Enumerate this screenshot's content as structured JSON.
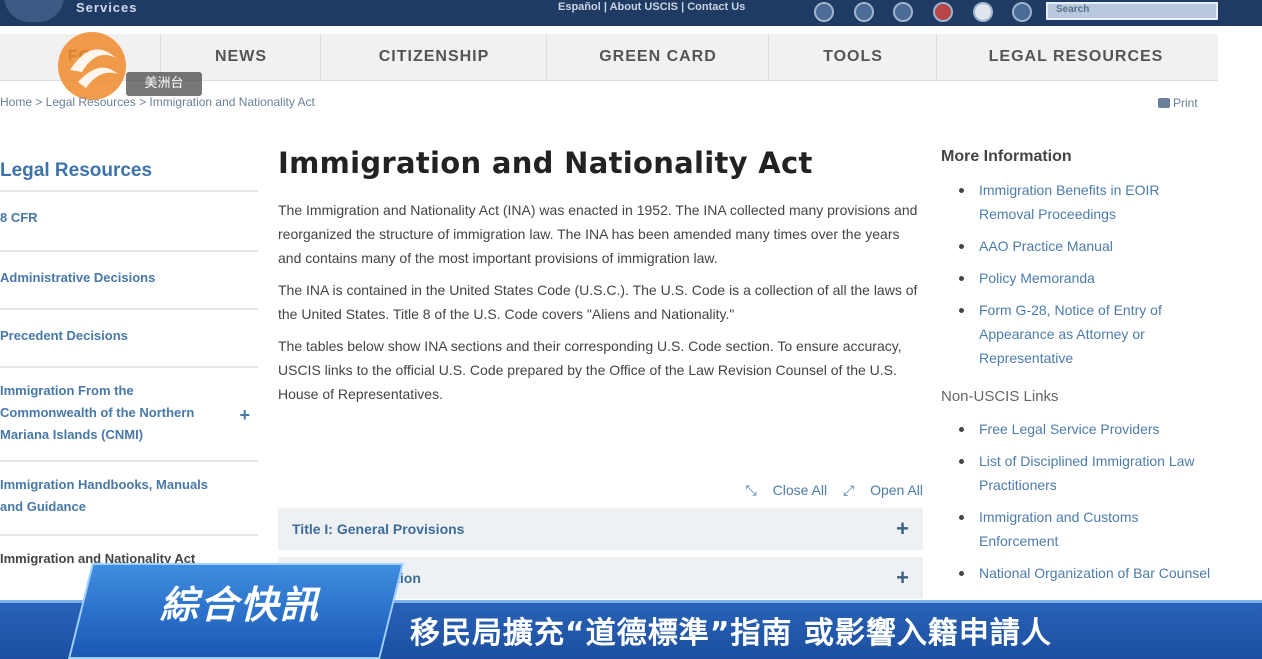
{
  "header": {
    "brand_text": "Services",
    "util_links": "Español | About USCIS | Contact Us",
    "search_placeholder": "Search"
  },
  "nav": {
    "items": [
      {
        "label": "FO"
      },
      {
        "label": "NEWS"
      },
      {
        "label": "CITIZENSHIP"
      },
      {
        "label": "GREEN CARD"
      },
      {
        "label": "TOOLS"
      },
      {
        "label": "LEGAL RESOURCES"
      }
    ]
  },
  "watermark": {
    "tag": "美洲台"
  },
  "breadcrumb": "Home > Legal Resources > Immigration and Nationality Act",
  "print_label": "Print",
  "sidebar": {
    "heading": "Legal Resources",
    "items": [
      {
        "label": "8 CFR"
      },
      {
        "label": "Administrative Decisions"
      },
      {
        "label": "Precedent Decisions"
      },
      {
        "label": "Immigration From the Commonwealth of the Northern Mariana Islands (CNMI)",
        "plus": "+"
      },
      {
        "label": "Immigration Handbooks, Manuals and Guidance"
      },
      {
        "label": "Immigration and Nationality Act"
      }
    ]
  },
  "main": {
    "title": "Immigration and Nationality Act",
    "paragraphs": [
      "The Immigration and Nationality Act (INA) was enacted in 1952. The INA collected many provisions and reorganized the structure of immigration law. The INA has been amended many times over the years and contains many of the most important provisions of immigration law.",
      "The INA is contained in the United States Code (U.S.C.). The U.S. Code is a collection of all the laws of the United States. Title 8 of the U.S. Code covers \"Aliens and Nationality.\"",
      "The tables below show INA sections and their corresponding U.S. Code section. To ensure accuracy, USCIS links to the official U.S. Code prepared by the Office of the Law Revision Counsel of the U.S. House of Representatives."
    ],
    "close_all": "Close All",
    "open_all": "Open All",
    "accordions": [
      {
        "label": "Title I: General Provisions",
        "plus": "+"
      },
      {
        "label": "Title II: Immigration",
        "plus": "+"
      }
    ]
  },
  "right": {
    "more_heading": "More Information",
    "more_links": [
      "Immigration Benefits in EOIR Removal Proceedings",
      "AAO Practice Manual",
      "Policy Memoranda",
      "Form G-28, Notice of Entry of Appearance as Attorney or Representative"
    ],
    "non_uscis_heading": "Non-USCIS Links",
    "non_uscis_links": [
      "Free Legal Service Providers",
      "List of Disciplined Immigration Law Practitioners",
      "Immigration and Customs Enforcement",
      "National Organization of Bar Counsel"
    ]
  },
  "banner": {
    "tag": "綜合快訊",
    "headline": "移民局擴充“道德標準”指南 或影響入籍申請人"
  }
}
